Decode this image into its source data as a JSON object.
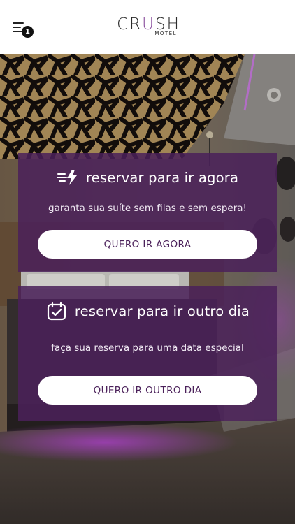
{
  "header": {
    "logo_main": "CRUSH",
    "logo_main_prefix": "CR",
    "logo_main_accent": "U",
    "logo_main_suffix": "SH",
    "logo_sub": "MOTEL",
    "menu_badge": "1",
    "menu_icon": "menu-icon"
  },
  "cards": {
    "now": {
      "title": "reservar para ir agora",
      "icon": "fast-lightning-icon",
      "description": "garanta sua suíte sem filas e sem espera!",
      "button_label": "QUERO IR AGORA"
    },
    "later": {
      "title": "reservar para ir outro dia",
      "icon": "calendar-check-icon",
      "description": "faça sua reserva para uma data especial",
      "button_label": "QUERO IR OUTRO DIA"
    }
  },
  "colors": {
    "card_purple": "#4b215a",
    "logo_accent": "#8a4f9e",
    "header_bg": "#ffffff"
  }
}
